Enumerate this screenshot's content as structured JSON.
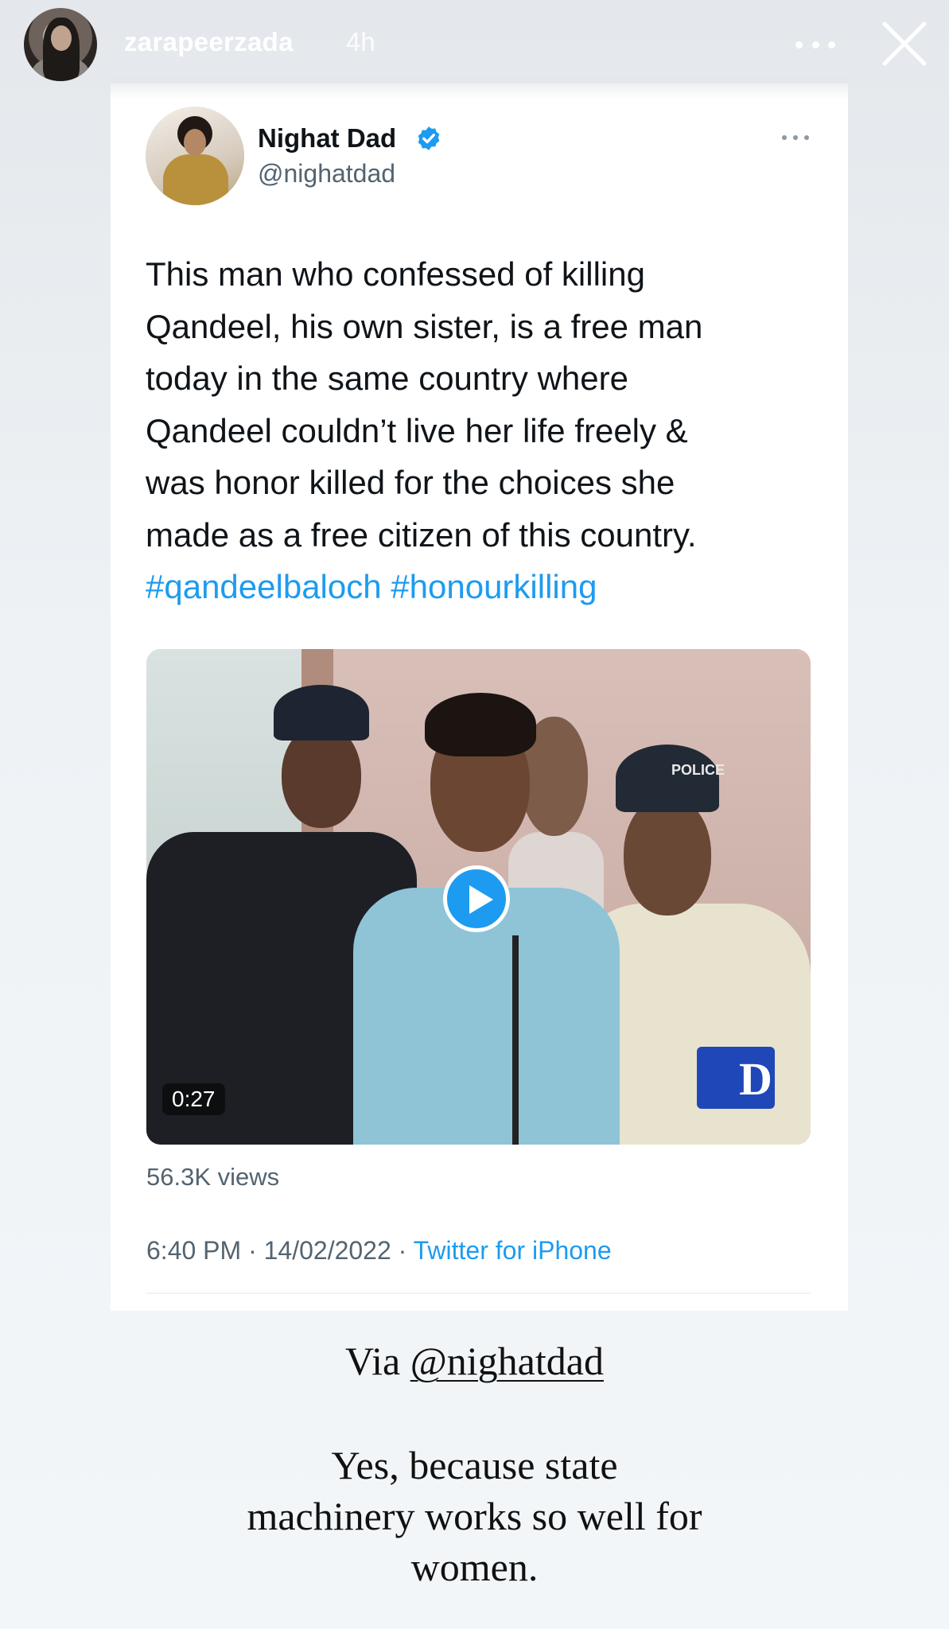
{
  "story": {
    "username": "zarapeerzada",
    "time_ago": "4h"
  },
  "tweet": {
    "author_name": "Nighat Dad",
    "author_handle": "@nighatdad",
    "text_lines": [
      "This man who confessed of killing",
      "Qandeel, his own sister, is a free man",
      "today in the same country where",
      "Qandeel couldn’t live her life freely &",
      "was honor killed for the choices she",
      "made as a free citizen of this country."
    ],
    "hashtags": "#qandeelbaloch #honourkilling",
    "video": {
      "duration": "0:27",
      "cap_text": "POLICE",
      "logo_letter": "D"
    },
    "views": "56.3K views",
    "time": "6:40 PM",
    "date": "14/02/2022",
    "client": "Twitter for iPhone",
    "separator": " · "
  },
  "captions": {
    "via_prefix": "Via ",
    "via_mention": "@nighatdad",
    "remark_lines": [
      "Yes, because state",
      "machinery works so well for",
      "women."
    ]
  },
  "icons": {
    "more": "more-horizontal-icon",
    "close": "close-icon",
    "verified": "verified-badge-icon",
    "play": "play-icon"
  },
  "colors": {
    "link": "#1d9bf0",
    "verified": "#1d9bf0",
    "text": "#0f1419",
    "muted": "#536471"
  }
}
